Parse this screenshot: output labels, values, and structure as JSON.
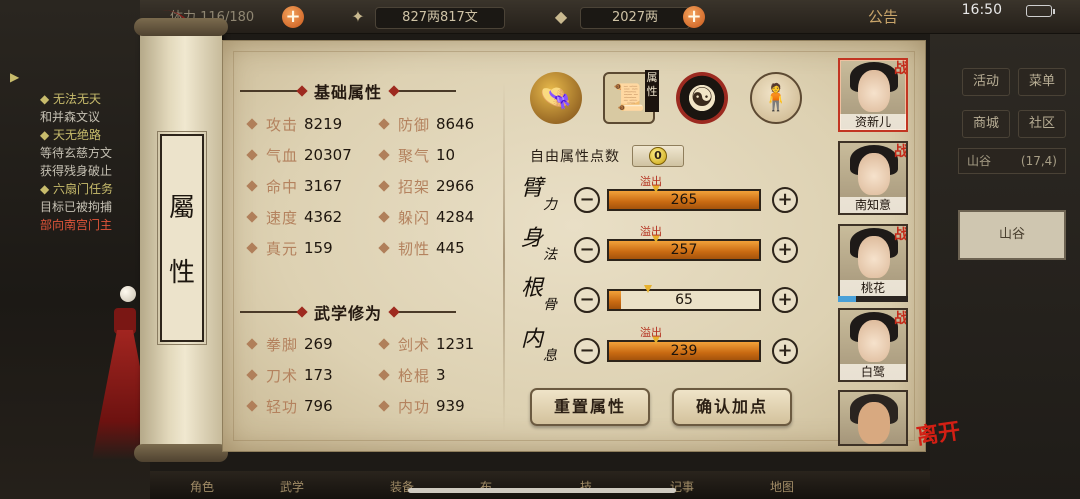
{
  "topbar": {
    "stamina": "体力 116/180",
    "copper": "827两817文",
    "gold": "2027两",
    "notice": "公告",
    "clock": "16:50"
  },
  "quests": [
    {
      "head": "◆ 无法无天",
      "body": "和并森文议"
    },
    {
      "head": "◆ 天无绝路",
      "body": "等待玄慈方文",
      "body2": "获得残身破止"
    },
    {
      "head": "◆ 六扇门任务",
      "body": "目标已被拘捕",
      "body3": "部向南宫门主"
    }
  ],
  "right_menu": {
    "items": [
      "活动",
      "菜单",
      "商城",
      "社区"
    ],
    "location": "山谷",
    "coords": "(17,4)",
    "list_item": "山谷"
  },
  "scroll": {
    "label_top": "屬",
    "label_bottom": "性"
  },
  "basic": {
    "title": "基础属性",
    "stats": [
      {
        "label": "攻击",
        "value": "8219"
      },
      {
        "label": "防御",
        "value": "8646"
      },
      {
        "label": "气血",
        "value": "20307"
      },
      {
        "label": "聚气",
        "value": "10"
      },
      {
        "label": "命中",
        "value": "3167"
      },
      {
        "label": "招架",
        "value": "2966"
      },
      {
        "label": "速度",
        "value": "4362"
      },
      {
        "label": "躲闪",
        "value": "4284"
      },
      {
        "label": "真元",
        "value": "159"
      },
      {
        "label": "韧性",
        "value": "445"
      }
    ]
  },
  "martial": {
    "title": "武学修为",
    "stats": [
      {
        "label": "拳脚",
        "value": "269"
      },
      {
        "label": "剑术",
        "value": "1231"
      },
      {
        "label": "刀术",
        "value": "173"
      },
      {
        "label": "枪棍",
        "value": "3"
      },
      {
        "label": "轻功",
        "value": "796"
      },
      {
        "label": "内功",
        "value": "939"
      }
    ]
  },
  "tabs": {
    "badge": "属性",
    "icons": [
      "hat-icon",
      "book-icon",
      "taiji-icon",
      "body-icon"
    ]
  },
  "free_points": {
    "label": "自由属性点数",
    "value": "0"
  },
  "attributes": [
    {
      "name_a": "臂",
      "name_b": "力",
      "value": "265",
      "fill": 1.0,
      "overflow": "溢出",
      "marker": 0.31
    },
    {
      "name_a": "身",
      "name_b": "法",
      "value": "257",
      "fill": 1.0,
      "overflow": "溢出",
      "marker": 0.31
    },
    {
      "name_a": "根",
      "name_b": "骨",
      "value": "65",
      "fill": 0.08,
      "overflow": "",
      "marker": 0.26
    },
    {
      "name_a": "内",
      "name_b": "息",
      "value": "239",
      "fill": 1.0,
      "overflow": "溢出",
      "marker": 0.31
    }
  ],
  "buttons": {
    "reset": "重置属性",
    "confirm": "确认加点"
  },
  "characters": [
    {
      "name": "资新儿",
      "tag": "战",
      "selected": true
    },
    {
      "name": "南知意",
      "tag": "战",
      "selected": false
    },
    {
      "name": "桃花",
      "tag": "战",
      "selected": false,
      "bar": 0.25
    },
    {
      "name": "白鹭",
      "tag": "战",
      "selected": false
    },
    {
      "name": "",
      "tag": "",
      "selected": false
    }
  ],
  "leave_label": "离开",
  "bottom_bar": [
    "角色",
    "武学",
    "装备",
    "布",
    "技",
    "记事",
    "地图"
  ],
  "colors": {
    "paper": "#e9dfc6",
    "accent_red": "#c42a1a",
    "bar_fill": "#e08a22",
    "label_brown": "#b4825e"
  }
}
